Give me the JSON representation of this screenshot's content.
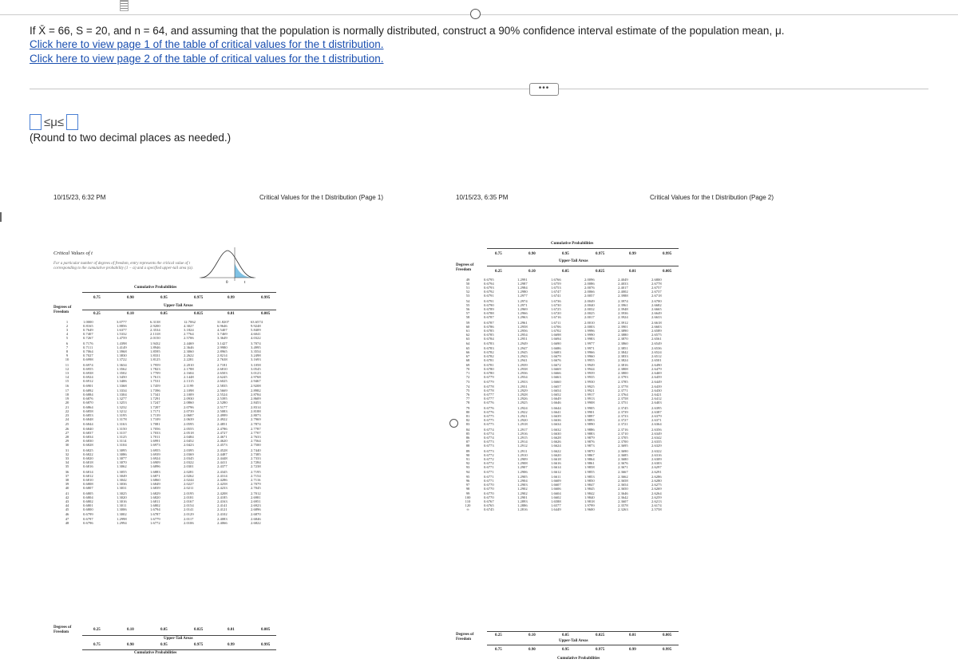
{
  "question": {
    "text": "If X̄ = 66, S = 20, and n = 64, and assuming that the population is normally distributed, construct a 90% confidence interval estimate of the population mean, μ.",
    "link1": "Click here to view page 1 of the table of critical values for the t distribution.",
    "link2": "Click here to view page 2 of the table of critical values for the t distribution.",
    "more_label": "•••"
  },
  "answer": {
    "lower_value": "",
    "upper_value": "",
    "symbol": "≤μ≤",
    "note": "(Round to two decimal places as needed.)"
  },
  "page1": {
    "timestamp": "10/15/23, 6:32 PM",
    "title": "Critical Values for the t Distribution (Page 1)",
    "table_title": "Critical Values of t",
    "desc": "For a particular number of degrees of freedom, entry represents the critical value of t corresponding to the cumulative probability (1 − α) and a specified upper-tail area (α).",
    "cum_prob_label": "Cumulative Probabilities",
    "upper_tail_label": "Upper-Tail Areas",
    "df_label": "Degrees of Freedom",
    "cum_probs": [
      "0.75",
      "0.90",
      "0.95",
      "0.975",
      "0.99",
      "0.995"
    ],
    "tails": [
      "0.25",
      "0.10",
      "0.05",
      "0.025",
      "0.01",
      "0.005"
    ],
    "chart_axis": [
      "0",
      "t"
    ],
    "rows": [
      [
        "1",
        "1.0000",
        "3.0777",
        "6.3138",
        "12.7062",
        "31.8207",
        "63.6574"
      ],
      [
        "2",
        "0.8165",
        "1.8856",
        "2.9200",
        "4.3027",
        "6.9646",
        "9.9248"
      ],
      [
        "3",
        "0.7649",
        "1.6377",
        "2.3534",
        "3.1824",
        "4.5407",
        "5.8409"
      ],
      [
        "4",
        "0.7407",
        "1.5332",
        "2.1318",
        "2.7764",
        "3.7469",
        "4.6041"
      ],
      [
        "5",
        "0.7267",
        "1.4759",
        "2.0150",
        "2.5706",
        "3.3649",
        "4.0322"
      ],
      [
        "6",
        "0.7176",
        "1.4398",
        "1.9432",
        "2.4469",
        "3.1427",
        "3.7074"
      ],
      [
        "7",
        "0.7111",
        "1.4149",
        "1.8946",
        "2.3646",
        "2.9980",
        "3.4995"
      ],
      [
        "8",
        "0.7064",
        "1.3968",
        "1.8595",
        "2.3060",
        "2.8965",
        "3.3554"
      ],
      [
        "9",
        "0.7027",
        "1.3830",
        "1.8331",
        "2.2622",
        "2.8214",
        "3.2498"
      ],
      [
        "10",
        "0.6998",
        "1.3722",
        "1.8125",
        "2.2281",
        "2.7638",
        "3.1693"
      ],
      [
        "11",
        "0.6974",
        "1.3634",
        "1.7959",
        "2.2010",
        "2.7181",
        "3.1058"
      ],
      [
        "12",
        "0.6955",
        "1.3562",
        "1.7823",
        "2.1788",
        "2.6810",
        "3.0545"
      ],
      [
        "13",
        "0.6938",
        "1.3502",
        "1.7709",
        "2.1604",
        "2.6503",
        "3.0123"
      ],
      [
        "14",
        "0.6924",
        "1.3450",
        "1.7613",
        "2.1448",
        "2.6245",
        "2.9768"
      ],
      [
        "15",
        "0.6912",
        "1.3406",
        "1.7531",
        "2.1315",
        "2.6025",
        "2.9467"
      ],
      [
        "16",
        "0.6901",
        "1.3368",
        "1.7459",
        "2.1199",
        "2.5835",
        "2.9208"
      ],
      [
        "17",
        "0.6892",
        "1.3334",
        "1.7396",
        "2.1098",
        "2.5669",
        "2.8982"
      ],
      [
        "18",
        "0.6884",
        "1.3304",
        "1.7341",
        "2.1009",
        "2.5524",
        "2.8784"
      ],
      [
        "19",
        "0.6876",
        "1.3277",
        "1.7291",
        "2.0930",
        "2.5395",
        "2.8609"
      ],
      [
        "20",
        "0.6870",
        "1.3253",
        "1.7247",
        "2.0860",
        "2.5280",
        "2.8453"
      ],
      [
        "21",
        "0.6864",
        "1.3232",
        "1.7207",
        "2.0796",
        "2.5177",
        "2.8314"
      ],
      [
        "22",
        "0.6858",
        "1.3212",
        "1.7171",
        "2.0739",
        "2.5083",
        "2.8188"
      ],
      [
        "23",
        "0.6853",
        "1.3195",
        "1.7139",
        "2.0687",
        "2.4999",
        "2.8073"
      ],
      [
        "24",
        "0.6848",
        "1.3178",
        "1.7109",
        "2.0639",
        "2.4922",
        "2.7969"
      ],
      [
        "25",
        "0.6844",
        "1.3163",
        "1.7081",
        "2.0595",
        "2.4851",
        "2.7874"
      ],
      [
        "26",
        "0.6840",
        "1.3150",
        "1.7056",
        "2.0555",
        "2.4786",
        "2.7787"
      ],
      [
        "27",
        "0.6837",
        "1.3137",
        "1.7033",
        "2.0518",
        "2.4727",
        "2.7707"
      ],
      [
        "28",
        "0.6834",
        "1.3125",
        "1.7011",
        "2.0484",
        "2.4671",
        "2.7633"
      ],
      [
        "29",
        "0.6830",
        "1.3114",
        "1.6991",
        "2.0452",
        "2.4620",
        "2.7564"
      ],
      [
        "30",
        "0.6828",
        "1.3104",
        "1.6973",
        "2.0423",
        "2.4573",
        "2.7500"
      ],
      [
        "31",
        "0.6825",
        "1.3095",
        "1.6955",
        "2.0395",
        "2.4528",
        "2.7440"
      ],
      [
        "32",
        "0.6822",
        "1.3086",
        "1.6939",
        "2.0369",
        "2.4487",
        "2.7385"
      ],
      [
        "33",
        "0.6820",
        "1.3077",
        "1.6924",
        "2.0345",
        "2.4448",
        "2.7333"
      ],
      [
        "34",
        "0.6818",
        "1.3070",
        "1.6909",
        "2.0322",
        "2.4411",
        "2.7284"
      ],
      [
        "35",
        "0.6816",
        "1.3062",
        "1.6896",
        "2.0301",
        "2.4377",
        "2.7238"
      ],
      [
        "36",
        "0.6814",
        "1.3055",
        "1.6883",
        "2.0281",
        "2.4345",
        "2.7195"
      ],
      [
        "37",
        "0.6812",
        "1.3049",
        "1.6871",
        "2.0262",
        "2.4314",
        "2.7154"
      ],
      [
        "38",
        "0.6810",
        "1.3042",
        "1.6860",
        "2.0244",
        "2.4286",
        "2.7116"
      ],
      [
        "39",
        "0.6808",
        "1.3036",
        "1.6849",
        "2.0227",
        "2.4258",
        "2.7079"
      ],
      [
        "40",
        "0.6807",
        "1.3031",
        "1.6839",
        "2.0211",
        "2.4233",
        "2.7045"
      ],
      [
        "41",
        "0.6805",
        "1.3025",
        "1.6829",
        "2.0195",
        "2.4208",
        "2.7012"
      ],
      [
        "42",
        "0.6804",
        "1.3020",
        "1.6820",
        "2.0181",
        "2.4185",
        "2.6981"
      ],
      [
        "43",
        "0.6802",
        "1.3016",
        "1.6811",
        "2.0167",
        "2.4163",
        "2.6951"
      ],
      [
        "44",
        "0.6801",
        "1.3011",
        "1.6802",
        "2.0154",
        "2.4141",
        "2.6923"
      ],
      [
        "45",
        "0.6800",
        "1.3006",
        "1.6794",
        "2.0141",
        "2.4121",
        "2.6896"
      ],
      [
        "46",
        "0.6799",
        "1.3002",
        "1.6787",
        "2.0129",
        "2.4102",
        "2.6870"
      ],
      [
        "47",
        "0.6797",
        "1.2998",
        "1.6779",
        "2.0117",
        "2.4083",
        "2.6846"
      ],
      [
        "48",
        "0.6796",
        "1.2994",
        "1.6772",
        "2.0106",
        "2.4066",
        "2.6822"
      ]
    ]
  },
  "page2": {
    "timestamp": "10/15/23, 6:35 PM",
    "title": "Critical Values for the t Distribution (Page 2)",
    "cum_prob_label": "Cumulative Probabilities",
    "upper_tail_label": "Upper-Tail Areas",
    "df_label": "Degrees of Freedom",
    "cum_probs": [
      "0.75",
      "0.90",
      "0.95",
      "0.975",
      "0.99",
      "0.995"
    ],
    "tails": [
      "0.25",
      "0.10",
      "0.05",
      "0.025",
      "0.01",
      "0.005"
    ],
    "rows": [
      [
        "49",
        "0.6795",
        "1.2991",
        "1.6766",
        "2.0096",
        "2.4049",
        "2.6800"
      ],
      [
        "50",
        "0.6794",
        "1.2987",
        "1.6759",
        "2.0086",
        "2.4033",
        "2.6778"
      ],
      [
        "51",
        "0.6793",
        "1.2984",
        "1.6753",
        "2.0076",
        "2.4017",
        "2.6757"
      ],
      [
        "52",
        "0.6792",
        "1.2980",
        "1.6747",
        "2.0066",
        "2.4002",
        "2.6737"
      ],
      [
        "53",
        "0.6791",
        "1.2977",
        "1.6741",
        "2.0057",
        "2.3988",
        "2.6718"
      ],
      [
        "54",
        "0.6791",
        "1.2974",
        "1.6736",
        "2.0049",
        "2.3974",
        "2.6700"
      ],
      [
        "55",
        "0.6790",
        "1.2971",
        "1.6730",
        "2.0040",
        "2.3961",
        "2.6682"
      ],
      [
        "56",
        "0.6789",
        "1.2969",
        "1.6725",
        "2.0032",
        "2.3948",
        "2.6665"
      ],
      [
        "57",
        "0.6788",
        "1.2966",
        "1.6720",
        "2.0025",
        "2.3936",
        "2.6649"
      ],
      [
        "58",
        "0.6787",
        "1.2963",
        "1.6716",
        "2.0017",
        "2.3924",
        "2.6633"
      ],
      [
        "59",
        "0.6787",
        "1.2961",
        "1.6711",
        "2.0010",
        "2.3912",
        "2.6618"
      ],
      [
        "60",
        "0.6786",
        "1.2958",
        "1.6706",
        "2.0003",
        "2.3901",
        "2.6603"
      ],
      [
        "61",
        "0.6785",
        "1.2956",
        "1.6702",
        "1.9996",
        "2.3890",
        "2.6589"
      ],
      [
        "62",
        "0.6785",
        "1.2954",
        "1.6698",
        "1.9990",
        "2.3880",
        "2.6575"
      ],
      [
        "63",
        "0.6784",
        "1.2951",
        "1.6694",
        "1.9983",
        "2.3870",
        "2.6561"
      ],
      [
        "64",
        "0.6783",
        "1.2949",
        "1.6690",
        "1.9977",
        "2.3860",
        "2.6549"
      ],
      [
        "65",
        "0.6783",
        "1.2947",
        "1.6686",
        "1.9971",
        "2.3851",
        "2.6536"
      ],
      [
        "66",
        "0.6782",
        "1.2945",
        "1.6683",
        "1.9966",
        "2.3842",
        "2.6524"
      ],
      [
        "67",
        "0.6782",
        "1.2943",
        "1.6679",
        "1.9960",
        "2.3833",
        "2.6512"
      ],
      [
        "68",
        "0.6781",
        "1.2941",
        "1.6676",
        "1.9955",
        "2.3824",
        "2.6501"
      ],
      [
        "69",
        "0.6781",
        "1.2939",
        "1.6672",
        "1.9949",
        "2.3816",
        "2.6490"
      ],
      [
        "70",
        "0.6780",
        "1.2938",
        "1.6669",
        "1.9944",
        "2.3808",
        "2.6479"
      ],
      [
        "71",
        "0.6780",
        "1.2936",
        "1.6666",
        "1.9939",
        "2.3800",
        "2.6469"
      ],
      [
        "72",
        "0.6779",
        "1.2934",
        "1.6663",
        "1.9935",
        "2.3793",
        "2.6459"
      ],
      [
        "73",
        "0.6779",
        "1.2933",
        "1.6660",
        "1.9930",
        "2.3785",
        "2.6449"
      ],
      [
        "74",
        "0.6778",
        "1.2931",
        "1.6657",
        "1.9925",
        "2.3778",
        "2.6439"
      ],
      [
        "75",
        "0.6778",
        "1.2929",
        "1.6654",
        "1.9921",
        "2.3771",
        "2.6430"
      ],
      [
        "76",
        "0.6777",
        "1.2928",
        "1.6652",
        "1.9917",
        "2.3764",
        "2.6421"
      ],
      [
        "77",
        "0.6777",
        "1.2926",
        "1.6649",
        "1.9913",
        "2.3758",
        "2.6412"
      ],
      [
        "78",
        "0.6776",
        "1.2925",
        "1.6646",
        "1.9908",
        "2.3751",
        "2.6403"
      ],
      [
        "79",
        "0.6776",
        "1.2924",
        "1.6644",
        "1.9905",
        "2.3745",
        "2.6395"
      ],
      [
        "80",
        "0.6776",
        "1.2922",
        "1.6641",
        "1.9901",
        "2.3739",
        "2.6387"
      ],
      [
        "81",
        "0.6775",
        "1.2921",
        "1.6639",
        "1.9897",
        "2.3733",
        "2.6379"
      ],
      [
        "82",
        "0.6775",
        "1.2920",
        "1.6636",
        "1.9893",
        "2.3727",
        "2.6371"
      ],
      [
        "83",
        "0.6775",
        "1.2918",
        "1.6634",
        "1.9890",
        "2.3721",
        "2.6364"
      ],
      [
        "84",
        "0.6774",
        "1.2917",
        "1.6632",
        "1.9886",
        "2.3716",
        "2.6356"
      ],
      [
        "85",
        "0.6774",
        "1.2916",
        "1.6630",
        "1.9883",
        "2.3710",
        "2.6349"
      ],
      [
        "86",
        "0.6774",
        "1.2915",
        "1.6628",
        "1.9879",
        "2.3705",
        "2.6342"
      ],
      [
        "87",
        "0.6773",
        "1.2914",
        "1.6626",
        "1.9876",
        "2.3700",
        "2.6335"
      ],
      [
        "88",
        "0.6773",
        "1.2912",
        "1.6624",
        "1.9873",
        "2.3695",
        "2.6329"
      ],
      [
        "89",
        "0.6773",
        "1.2911",
        "1.6622",
        "1.9870",
        "2.3690",
        "2.6322"
      ],
      [
        "90",
        "0.6772",
        "1.2910",
        "1.6620",
        "1.9867",
        "2.3685",
        "2.6316"
      ],
      [
        "91",
        "0.6772",
        "1.2909",
        "1.6618",
        "1.9864",
        "2.3680",
        "2.6309"
      ],
      [
        "92",
        "0.6772",
        "1.2908",
        "1.6616",
        "1.9861",
        "2.3676",
        "2.6303"
      ],
      [
        "93",
        "0.6771",
        "1.2907",
        "1.6614",
        "1.9858",
        "2.3671",
        "2.6297"
      ],
      [
        "94",
        "0.6771",
        "1.2906",
        "1.6612",
        "1.9855",
        "2.3667",
        "2.6291"
      ],
      [
        "95",
        "0.6771",
        "1.2905",
        "1.6611",
        "1.9853",
        "2.3662",
        "2.6286"
      ],
      [
        "96",
        "0.6771",
        "1.2904",
        "1.6609",
        "1.9850",
        "2.3658",
        "2.6280"
      ],
      [
        "97",
        "0.6770",
        "1.2903",
        "1.6607",
        "1.9847",
        "2.3654",
        "2.6275"
      ],
      [
        "98",
        "0.6770",
        "1.2902",
        "1.6606",
        "1.9845",
        "2.3650",
        "2.6269"
      ],
      [
        "99",
        "0.6770",
        "1.2902",
        "1.6604",
        "1.9842",
        "2.3646",
        "2.6264"
      ],
      [
        "100",
        "0.6770",
        "1.2901",
        "1.6602",
        "1.9840",
        "2.3642",
        "2.6259"
      ],
      [
        "110",
        "0.6767",
        "1.2893",
        "1.6588",
        "1.9818",
        "2.3607",
        "2.6213"
      ],
      [
        "120",
        "0.6765",
        "1.2886",
        "1.6577",
        "1.9799",
        "2.3578",
        "2.6174"
      ],
      [
        "∞",
        "0.6745",
        "1.2816",
        "1.6449",
        "1.9600",
        "2.3263",
        "2.5758"
      ]
    ]
  }
}
